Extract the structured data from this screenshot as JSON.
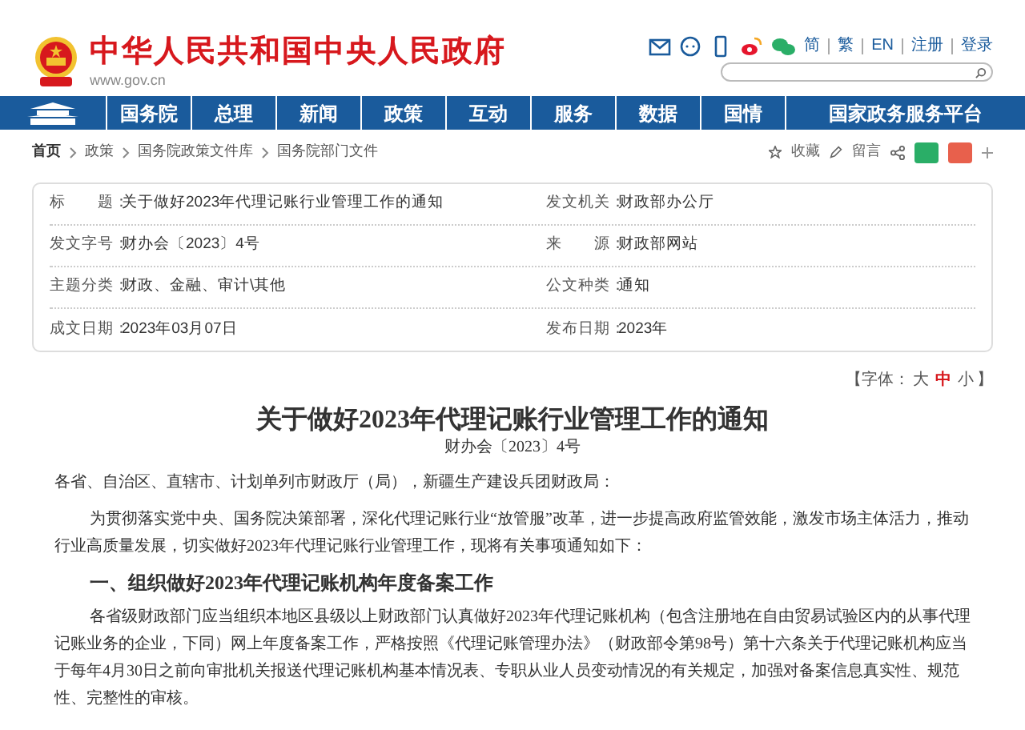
{
  "header": {
    "site_title": "中华人民共和国中央人民政府",
    "site_url": "www.gov.cn",
    "links": [
      "简",
      "繁",
      "EN",
      "注册",
      "登录"
    ]
  },
  "nav": {
    "items": [
      "国务院",
      "总理",
      "新闻",
      "政策",
      "互动",
      "服务",
      "数据",
      "国情",
      "国家政务服务平台"
    ]
  },
  "breadcrumb": {
    "items": [
      "首页",
      "政策",
      "国务院政策文件库",
      "国务院部门文件"
    ],
    "actions": [
      "收藏",
      "留言"
    ]
  },
  "info": {
    "rows": [
      {
        "label": "标　　题：",
        "value": "关于做好2023年代理记账行业管理工作的通知",
        "label2": "发文机关：",
        "value2": "财政部办公厅"
      },
      {
        "label": "发文字号：",
        "value": "财办会〔2023〕4号",
        "label2": "来　　源：",
        "value2": "财政部网站"
      },
      {
        "label": "主题分类：",
        "value": "财政、金融、审计\\其他",
        "label2": "公文种类：",
        "value2": "通知"
      },
      {
        "label": "成文日期：",
        "value": "2023年03月07日",
        "label2": "发布日期：",
        "value2": "2023年"
      }
    ]
  },
  "font_size": {
    "prefix": "【字体：",
    "sizes": [
      {
        "label": "大",
        "selected": false
      },
      {
        "label": "中",
        "selected": true
      },
      {
        "label": "小",
        "selected": false
      }
    ],
    "suffix": "】"
  },
  "article": {
    "title": "关于做好2023年代理记账行业管理工作的通知",
    "doc_number": "财办会〔2023〕4号",
    "blocks": [
      {
        "kind": "salutation",
        "text": "各省、自治区、直辖市、计划单列市财政厅（局），新疆生产建设兵团财政局："
      },
      {
        "kind": "paragraph",
        "text": "为贯彻落实党中央、国务院决策部署，深化代理记账行业“放管服”改革，进一步提高政府监管效能，激发市场主体活力，推动行业高质量发展，切实做好2023年代理记账行业管理工作，现将有关事项通知如下："
      },
      {
        "kind": "heading",
        "text": "一、组织做好2023年代理记账机构年度备案工作"
      },
      {
        "kind": "paragraph",
        "text": "各省级财政部门应当组织本地区县级以上财政部门认真做好2023年代理记账机构（包含注册地在自由贸易试验区内的从事代理记账业务的企业，下同）网上年度备案工作，严格按照《代理记账管理办法》（财政部令第98号）第十六条关于代理记账机构应当于每年4月30日之前向审批机关报送代理记账机构基本情况表、专职从业人员变动情况的有关规定，加强对备案信息真实性、规范性、完整性的审核。"
      }
    ]
  }
}
